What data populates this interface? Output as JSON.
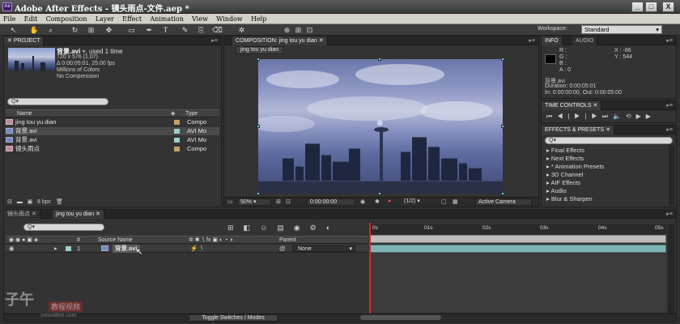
{
  "window": {
    "title": "Adobe After Effects - 镜头雨点-文件.aep *",
    "app_icon": "Ae",
    "min": "_",
    "max": "□",
    "close": "X"
  },
  "menu": [
    "File",
    "Edit",
    "Composition",
    "Layer",
    "Effect",
    "Animation",
    "View",
    "Window",
    "Help"
  ],
  "toolbar": {
    "workspace_label": "Workspace:",
    "workspace_value": "Standard"
  },
  "project": {
    "tab": "PROJECT",
    "selected_name": "背景.avi",
    "selected_suffix": ", used 1 time",
    "info": [
      "720 x 576 (1.07)",
      "Δ 0:00:05:01, 25.00 fps",
      "Millions of Colors",
      "No Compression"
    ],
    "search_placeholder": "Q▾",
    "col_name": "Name",
    "col_type": "Type",
    "items": [
      {
        "name": "jing tou yu dian",
        "type": "Compo",
        "color": "#c7a06a",
        "kind": "comp"
      },
      {
        "name": "背景.avi",
        "type": "AVI Mo",
        "color": "#9ccfcf",
        "kind": "footage"
      },
      {
        "name": "背景.avi",
        "type": "AVI Mo",
        "color": "#9ccfcf",
        "kind": "footage"
      },
      {
        "name": "镜头雨点",
        "type": "Compo",
        "color": "#c7a06a",
        "kind": "comp"
      }
    ],
    "bpc": "8 bpc"
  },
  "comp": {
    "tab": "COMPOSITION: jing tou yu dian",
    "subtab": "jing tou yu dian",
    "zoom": "50%",
    "timecode": "0:00:00:00",
    "resolution": "(1/2)",
    "camera": "Active Camera"
  },
  "info": {
    "tab": "INFO",
    "tab2": "AUDIO",
    "rgba": [
      "R :",
      "G :",
      "B :",
      "A : 0"
    ],
    "x": "X : -86",
    "y": "Y : 544",
    "name": "背景.avi",
    "duration": "Duration: 0:00:05:01",
    "inout": "In: 0:00:00:00, Out: 0:00:05:00"
  },
  "time_controls": {
    "tab": "TIME CONTROLS"
  },
  "effects": {
    "tab": "EFFECTS & PRESETS",
    "search_placeholder": "Q▾",
    "items": [
      "Final Effects",
      "Next Effects",
      "* Animation Presets",
      "3D Channel",
      "AIF Effects",
      "Audio",
      "Blur & Sharpen"
    ]
  },
  "timeline": {
    "tabs": [
      "镜头雨点",
      "jing tou yu dian"
    ],
    "search_placeholder": "Q▾",
    "col_num": "#",
    "col_source": "Source Name",
    "col_parent": "Parent",
    "layer_num": "1",
    "layer_name": "背景.avi",
    "parent_value": "None",
    "ruler": [
      "0s",
      "01s",
      "02s",
      "03s",
      "04s",
      "05s"
    ],
    "toggle_label": "Toggle Switches / Modes"
  },
  "watermark": {
    "title": "子午",
    "sub": "教程视频",
    "url": "zwuvideo.com"
  },
  "colors": {
    "comp_label": "#c7a06a",
    "footage_label": "#9ccfcf",
    "track_bar": "#7fb3b3",
    "playhead": "#d22"
  }
}
